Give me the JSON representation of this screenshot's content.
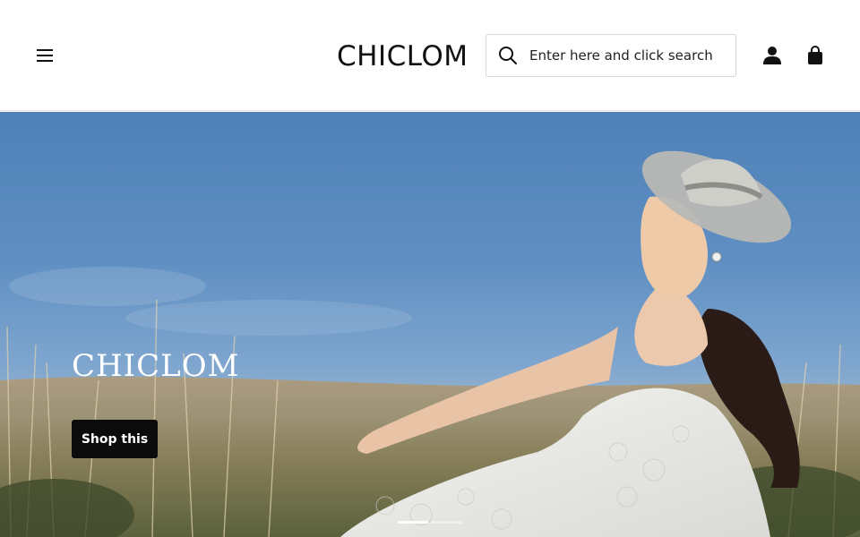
{
  "header": {
    "menu_icon": "hamburger-menu-icon",
    "logo": "CHICLOM",
    "search": {
      "icon": "search-icon",
      "placeholder": "Enter here and click search"
    },
    "account_icon": "user-icon",
    "cart_icon": "shopping-bag-icon"
  },
  "hero": {
    "title": "CHICLOM",
    "button_label": "Shop this",
    "slides": 2,
    "active_slide": 1
  },
  "colors": {
    "button_bg": "#0b0b0b",
    "sky": "#5f8fc2",
    "header_bg": "#ffffff"
  }
}
